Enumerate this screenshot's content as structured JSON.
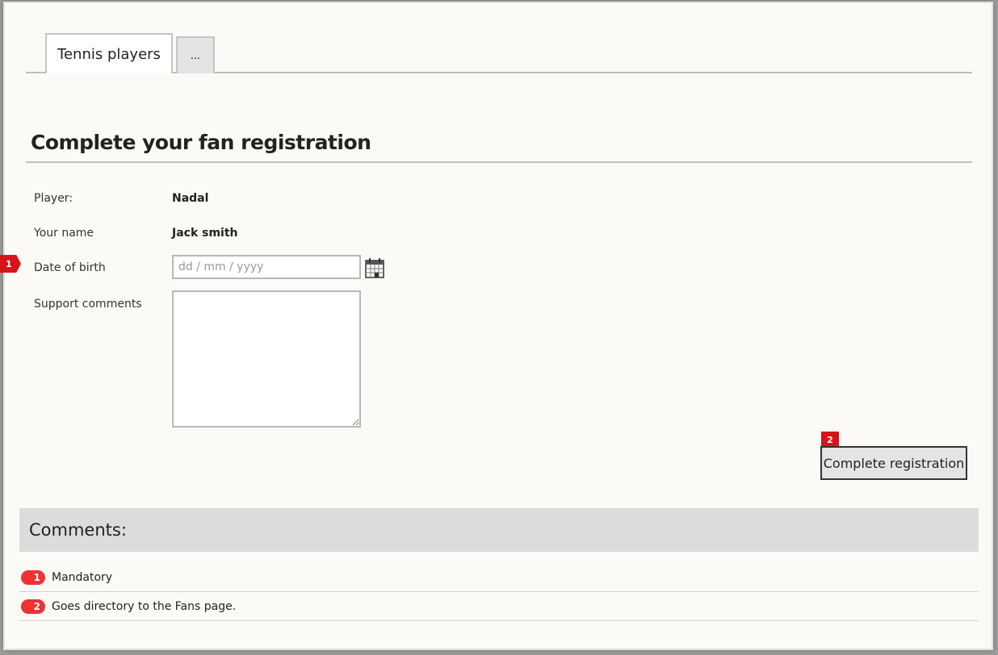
{
  "tabs": [
    {
      "label": "Tennis players",
      "active": true
    },
    {
      "label": "...",
      "active": false
    }
  ],
  "form": {
    "heading": "Complete your fan registration",
    "player_label": "Player:",
    "player_value": "Nadal",
    "name_label": "Your name",
    "name_value": "Jack smith",
    "dob_label": "Date of birth",
    "dob_placeholder": "dd / mm / yyyy",
    "dob_value": "",
    "support_label": "Support comments",
    "support_value": "",
    "submit_label": "Complete registration",
    "calendar_icon": "calendar-icon"
  },
  "markers": {
    "dob": "1",
    "submit": "2"
  },
  "comments": {
    "title": "Comments:",
    "items": [
      {
        "badge": "1",
        "text": "Mandatory"
      },
      {
        "badge": "2",
        "text": "Goes directory to the Fans page."
      }
    ]
  },
  "colors": {
    "marker": "#d7141b",
    "badge": "#ee3333",
    "comments_bar": "#dcdcdc"
  }
}
